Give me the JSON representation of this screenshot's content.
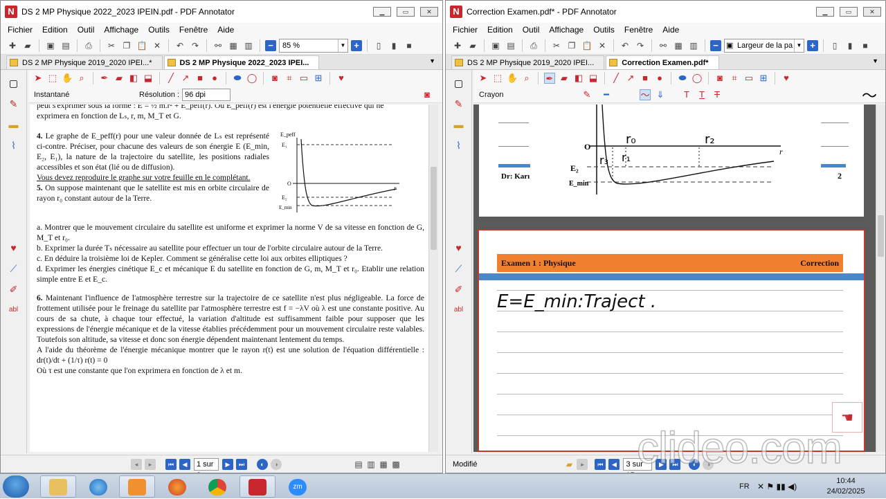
{
  "left_window": {
    "title": "DS 2 MP Physique 2022_2023 IPEIN.pdf - PDF Annotator",
    "menu": [
      "Fichier",
      "Edition",
      "Outil",
      "Affichage",
      "Outils",
      "Fenêtre",
      "Aide"
    ],
    "zoom_value": "85 %",
    "tabs": [
      {
        "label": "DS 2 MP Physique 2019_2020 IPEI...*",
        "active": false
      },
      {
        "label": "DS 2 MP Physique 2022_2023 IPEI...",
        "active": true
      }
    ],
    "tool_label": "Instantané",
    "resolution_label": "Résolution :",
    "resolution_value": "96 dpi",
    "page_indicator": "1 sur 2",
    "document": {
      "line0": "peut s'exprimer sous la forme : E = ½ m.ṙ² + E_peff(r). Où E_peff(r) est l'énergie potentielle effective qui ne",
      "line1": "exprimera en fonction de Lₛ, r, m, M_T et G.",
      "q4_num": "4.",
      "q4_text": "Le graphe de E_peff(r) pour une valeur donnée de Lₛ est représenté ci-contre. Préciser, pour chacune des valeurs de son énergie E (E_min, E₂, E₁), la nature de la trajectoire du satellite, les positions radiales accessibles et son état (lié ou de diffusion).",
      "q4_underline": "Vous devez reproduire le graphe sur votre feuille en le complétant.",
      "q5_num": "5.",
      "q5_text": "On suppose maintenant que le satellite est mis en orbite circulaire de rayon r₀ constant autour de la Terre.",
      "q5a": "a. Montrer que le mouvement circulaire du satellite est uniforme et exprimer la norme V de sa vitesse en fonction de G, M_T et r₀.",
      "q5b": "b. Exprimer la durée Tₛ nécessaire au satellite pour effectuer un tour de l'orbite circulaire autour de la Terre.",
      "q5c": "c. En déduire la troisième loi de Kepler. Comment se généralise cette loi aux orbites elliptiques ?",
      "q5d": "d. Exprimer les énergies cinétique E_c et mécanique E du satellite en fonction de G, m, M_T et r₀. Etablir une relation simple entre E et E_c.",
      "q6_num": "6.",
      "q6_text": "Maintenant l'influence de l'atmosphère terrestre sur la trajectoire de ce satellite n'est plus négligeable. La force de frottement utilisée pour le freinage du satellite par l'atmosphère terrestre est f = −λV où λ est une constante positive. Au cours de sa chute, à chaque tour effectué, la variation d'altitude est suffisamment faible pour supposer que les expressions de l'énergie mécanique et de la vitesse établies précédemment pour un mouvement circulaire reste valables. Toutefois son altitude, sa vitesse et donc son énergie dépendent maintenant lentement du temps.",
      "q6_line2": "A l'aide du théorème de l'énergie mécanique montrer que le rayon r(t) est une solution de l'équation différentielle : dr(t)/dt + (1/τ) r(t) = 0",
      "q6_line3": "Où τ est une constante que l'on exprimera en fonction de λ et m.",
      "graph_labels": {
        "y": "E_peff",
        "e1": "E₁",
        "o": "O",
        "e2": "E₂",
        "emin": "E_min",
        "x": "r"
      }
    }
  },
  "right_window": {
    "title": "Correction Examen.pdf* - PDF Annotator",
    "menu": [
      "Fichier",
      "Edition",
      "Outil",
      "Affichage",
      "Outils",
      "Fenêtre",
      "Aide"
    ],
    "zoom_value": "Largeur de la pa",
    "tabs": [
      {
        "label": "DS 2 MP Physique 2019_2020 IPEI...",
        "active": false
      },
      {
        "label": "Correction Examen.pdf*",
        "active": true
      }
    ],
    "tool_label": "Crayon",
    "status_text": "Modifié",
    "page_indicator": "3 sur 15",
    "page_top": {
      "footer_left": "Dr: Karı",
      "footer_right": "2",
      "graph_labels": {
        "o": "O",
        "r": "r",
        "e2": "E₂",
        "emin": "E_min",
        "r0": "r₀",
        "r1": "r₁",
        "r2": "r₂",
        "r3": "r₃"
      }
    },
    "page_main": {
      "header_left": "Examen 1 : Physique",
      "header_right": "Correction",
      "handwriting": "E=E_min:Traject ."
    }
  },
  "taskbar": {
    "lang": "FR",
    "time": "10:44",
    "date": "24/02/2025"
  },
  "watermark": "clideo.com",
  "colors": {
    "accent": "#2d64c8",
    "brand_red": "#c8282d",
    "header_orange": "#f07f2f",
    "header_blue": "#4a86c8"
  }
}
